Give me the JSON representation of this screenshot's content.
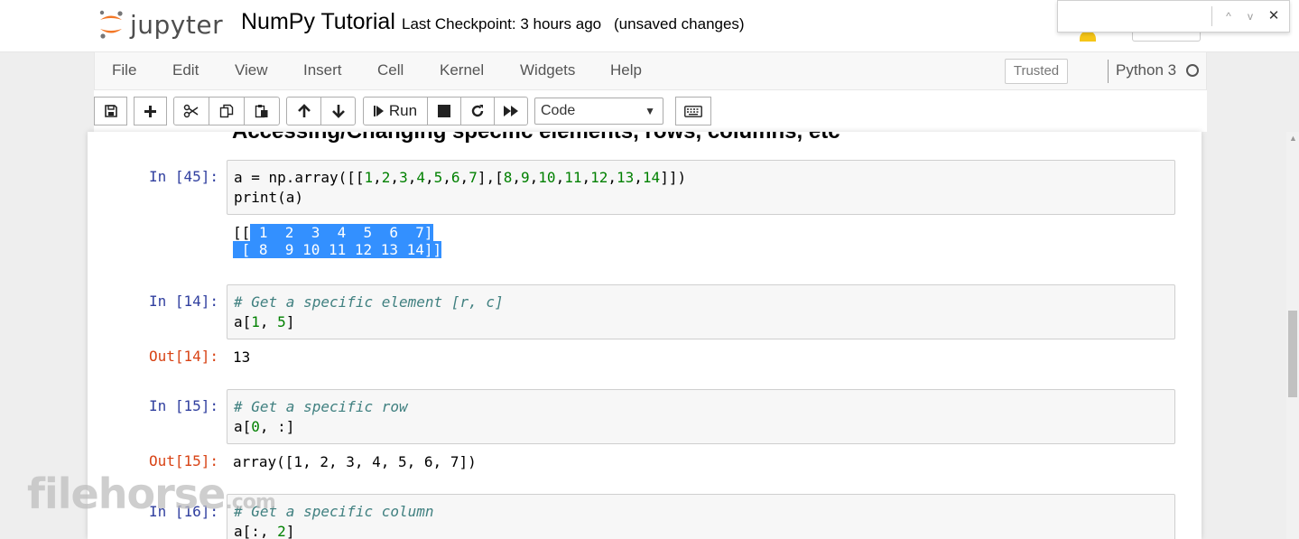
{
  "header": {
    "logo_text": "jupyter",
    "notebook_title": "NumPy Tutorial",
    "checkpoint": "Last Checkpoint: 3 hours ago",
    "save_status": "(unsaved changes)"
  },
  "findbar": {
    "value": "",
    "prev_glyph": "^",
    "next_glyph": "v",
    "close_glyph": "✕"
  },
  "menu": {
    "items": [
      "File",
      "Edit",
      "View",
      "Insert",
      "Cell",
      "Kernel",
      "Widgets",
      "Help"
    ],
    "trusted": "Trusted",
    "kernel_name": "Python 3"
  },
  "toolbar": {
    "run_label": "Run",
    "cell_type": "Code",
    "icons": [
      "save-icon",
      "plus-icon",
      "cut-icon",
      "copy-icon",
      "paste-icon",
      "arrow-up-icon",
      "arrow-down-icon",
      "run-icon",
      "stop-icon",
      "restart-icon",
      "fast-forward-icon",
      "keyboard-icon"
    ]
  },
  "notebook": {
    "partial_heading": "Accessing/Changing specific elements, rows, columns, etc",
    "cells": [
      {
        "in_prompt": "In [45]:",
        "code": [
          "a = np.array([[1,2,3,4,5,6,7],[8,9,10,11,12,13,14]])",
          "print(a)"
        ],
        "output_prompt": "",
        "output_lines": [
          "[[ 1  2  3  4  5  6  7]",
          " [ 8  9 10 11 12 13 14]]"
        ]
      },
      {
        "in_prompt": "In [14]:",
        "code": [
          "# Get a specific element [r, c]",
          "a[1, 5]"
        ],
        "output_prompt": "Out[14]:",
        "output_lines": [
          "13"
        ]
      },
      {
        "in_prompt": "In [15]:",
        "code": [
          "# Get a specific row",
          "a[0, :]"
        ],
        "output_prompt": "Out[15]:",
        "output_lines": [
          "array([1, 2, 3, 4, 5, 6, 7])"
        ]
      },
      {
        "in_prompt": "In [16]:",
        "code": [
          "# Get a specific column",
          "a[:, 2]"
        ],
        "output_prompt": "",
        "output_lines": []
      }
    ]
  },
  "watermark": {
    "text": "filehorse",
    "suffix": ".com"
  },
  "colors": {
    "prompt_in": "#303f9f",
    "prompt_out": "#d84315",
    "selection": "#3390ff",
    "number": "#008000",
    "comment": "#408080"
  }
}
